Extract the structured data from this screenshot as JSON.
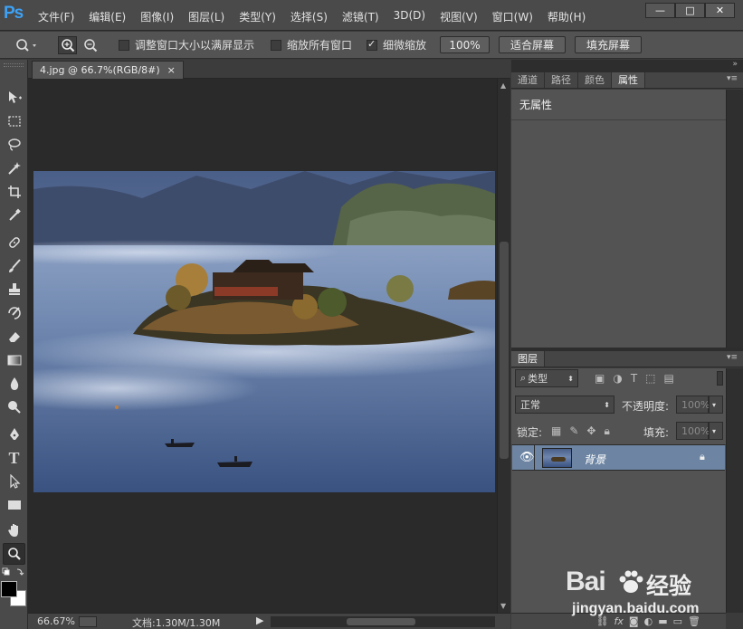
{
  "app": {
    "logo": "Ps",
    "menu": [
      "文件(F)",
      "编辑(E)",
      "图像(I)",
      "图层(L)",
      "类型(Y)",
      "选择(S)",
      "滤镜(T)",
      "3D(D)",
      "视图(V)",
      "窗口(W)",
      "帮助(H)"
    ],
    "window_controls": [
      "—",
      "□",
      "✕"
    ]
  },
  "options": {
    "resize_windows": "调整窗口大小以满屏显示",
    "zoom_all": "缩放所有窗口",
    "scrubby_zoom": "细微缩放",
    "btn_100": "100%",
    "btn_fit": "适合屏幕",
    "btn_fill": "填充屏幕",
    "resize_checked": false,
    "zoom_all_checked": false,
    "scrubby_checked": true
  },
  "document": {
    "tab_title": "4.jpg @ 66.7%(RGB/8#)",
    "tab_close": "×",
    "zoom": "66.67%",
    "doc_size": "文档:1.30M/1.30M"
  },
  "properties_panel": {
    "tabs": [
      "通道",
      "路径",
      "颜色",
      "属性"
    ],
    "active_tab": "属性",
    "content": "无属性"
  },
  "layers_panel": {
    "tab": "图层",
    "filter_kind": "类型",
    "blend_mode": "正常",
    "opacity_label": "不透明度:",
    "opacity_value": "100%",
    "lock_label": "锁定:",
    "fill_label": "填充:",
    "fill_value": "100%",
    "layers": [
      {
        "name": "背景",
        "visible": true,
        "locked": true
      }
    ],
    "footer_icons": [
      "link-icon",
      "fx-icon",
      "mask-icon",
      "adjustment-icon",
      "group-icon",
      "new-layer-icon",
      "trash-icon"
    ]
  },
  "watermark": {
    "brand": "Bai",
    "brand_cn": "经验",
    "url": "jingyan.baidu.com"
  },
  "colors": {
    "ps_blue": "#3da2f5",
    "selected_layer": "#6d85a3"
  }
}
